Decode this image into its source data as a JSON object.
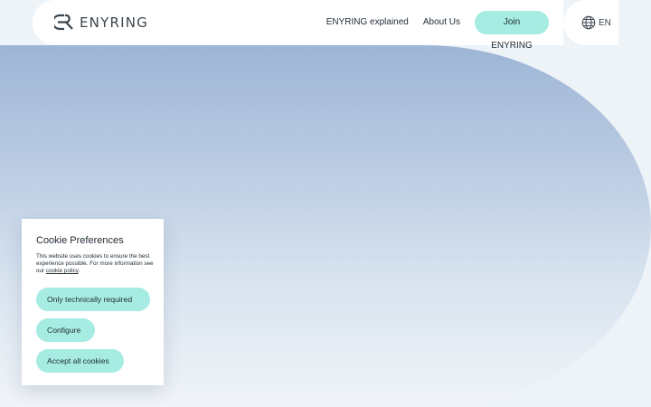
{
  "brand": {
    "name": "ENYRING",
    "accent": "#a6ece2"
  },
  "nav": {
    "links": [
      "ENYRING explained",
      "About Us"
    ],
    "join_label": "Join ENYRING"
  },
  "language": {
    "icon": "globe-icon",
    "code": "EN"
  },
  "cookie": {
    "title": "Cookie Preferences",
    "text": "This website uses cookies to ensure the best experience possible. For more information see our ",
    "link_text": "cookie policy",
    "text_end": ".",
    "buttons": {
      "only_required": "Only technically required",
      "configure": "Configure",
      "accept_all": "Accept all cookies"
    }
  }
}
